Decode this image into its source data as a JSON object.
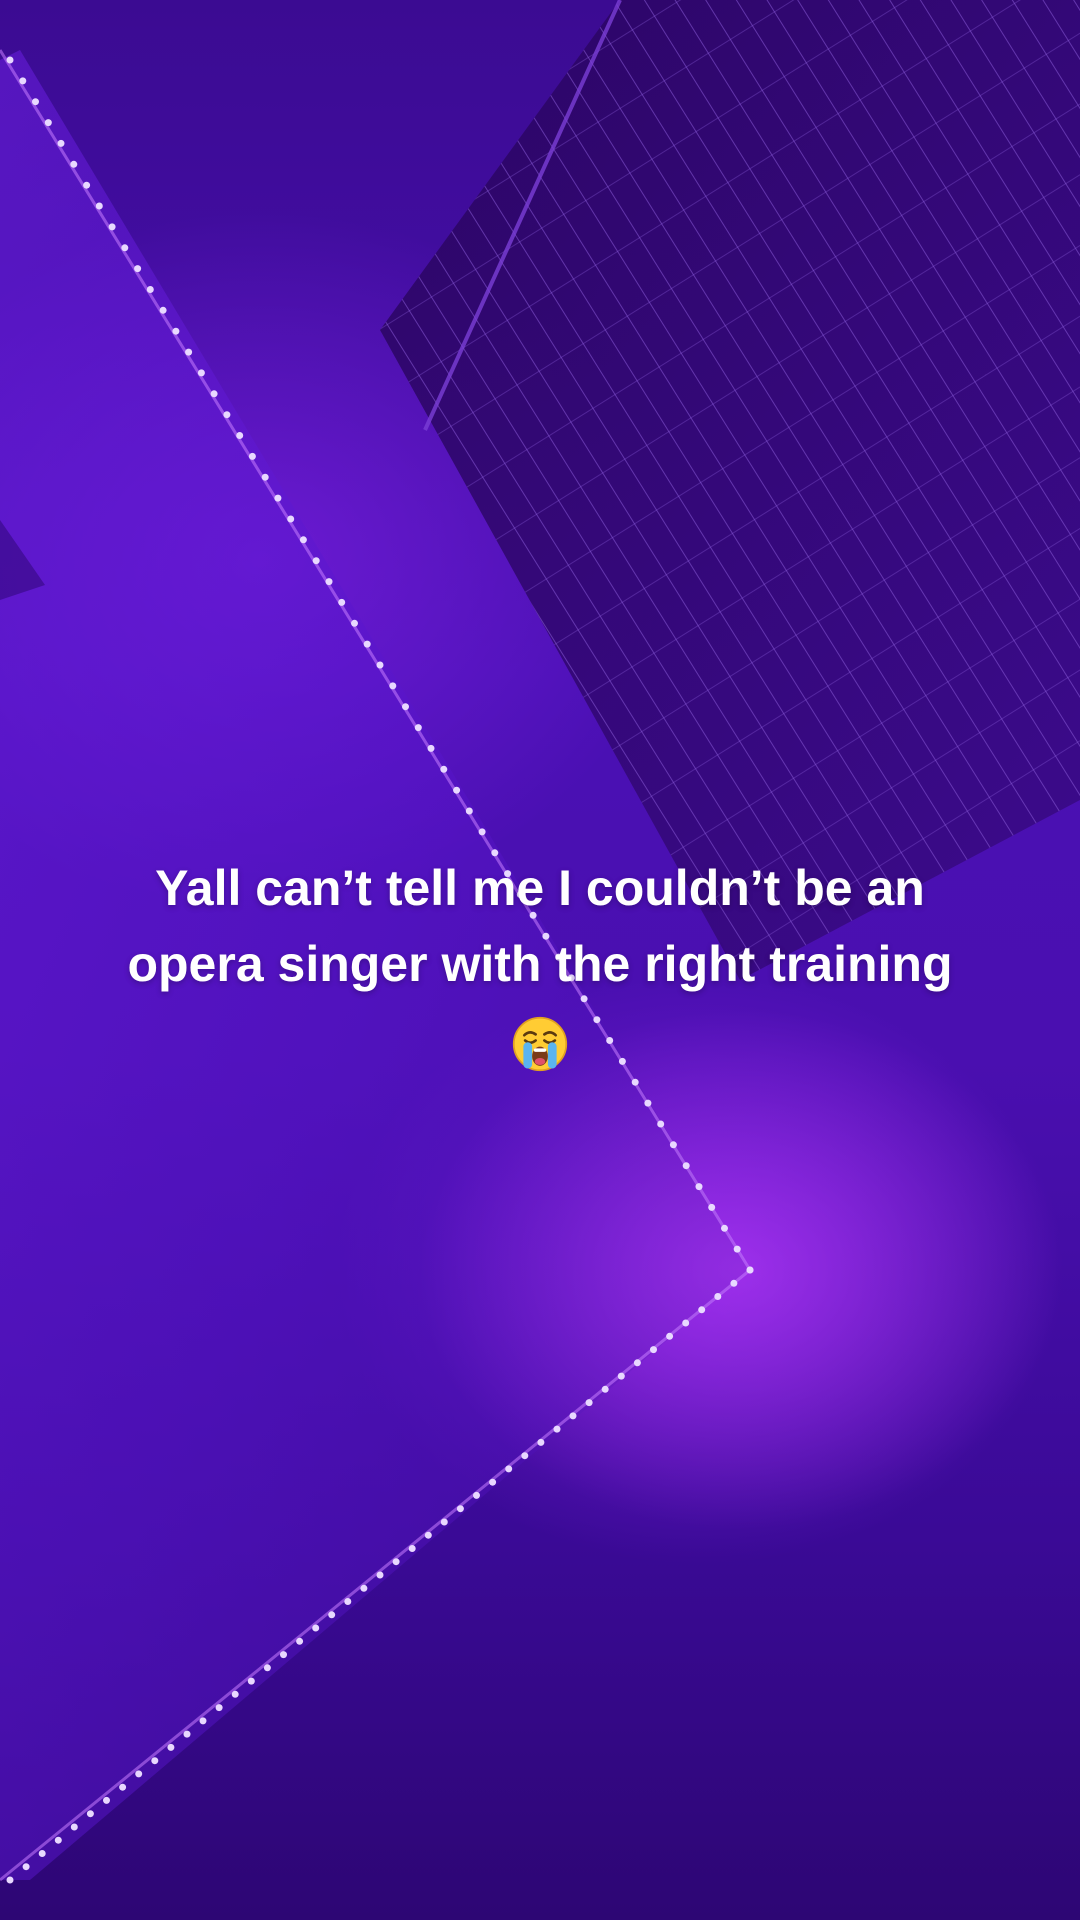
{
  "story": {
    "caption_line_1": "Yall can’t tell me I couldn’t be an",
    "caption_line_2": "opera singer with the right training",
    "emoji": "loudly-crying-face-emoji"
  },
  "colors": {
    "background": "#4a10b4",
    "led_light": "#e8d8ff",
    "caption_text": "#ffffff"
  }
}
